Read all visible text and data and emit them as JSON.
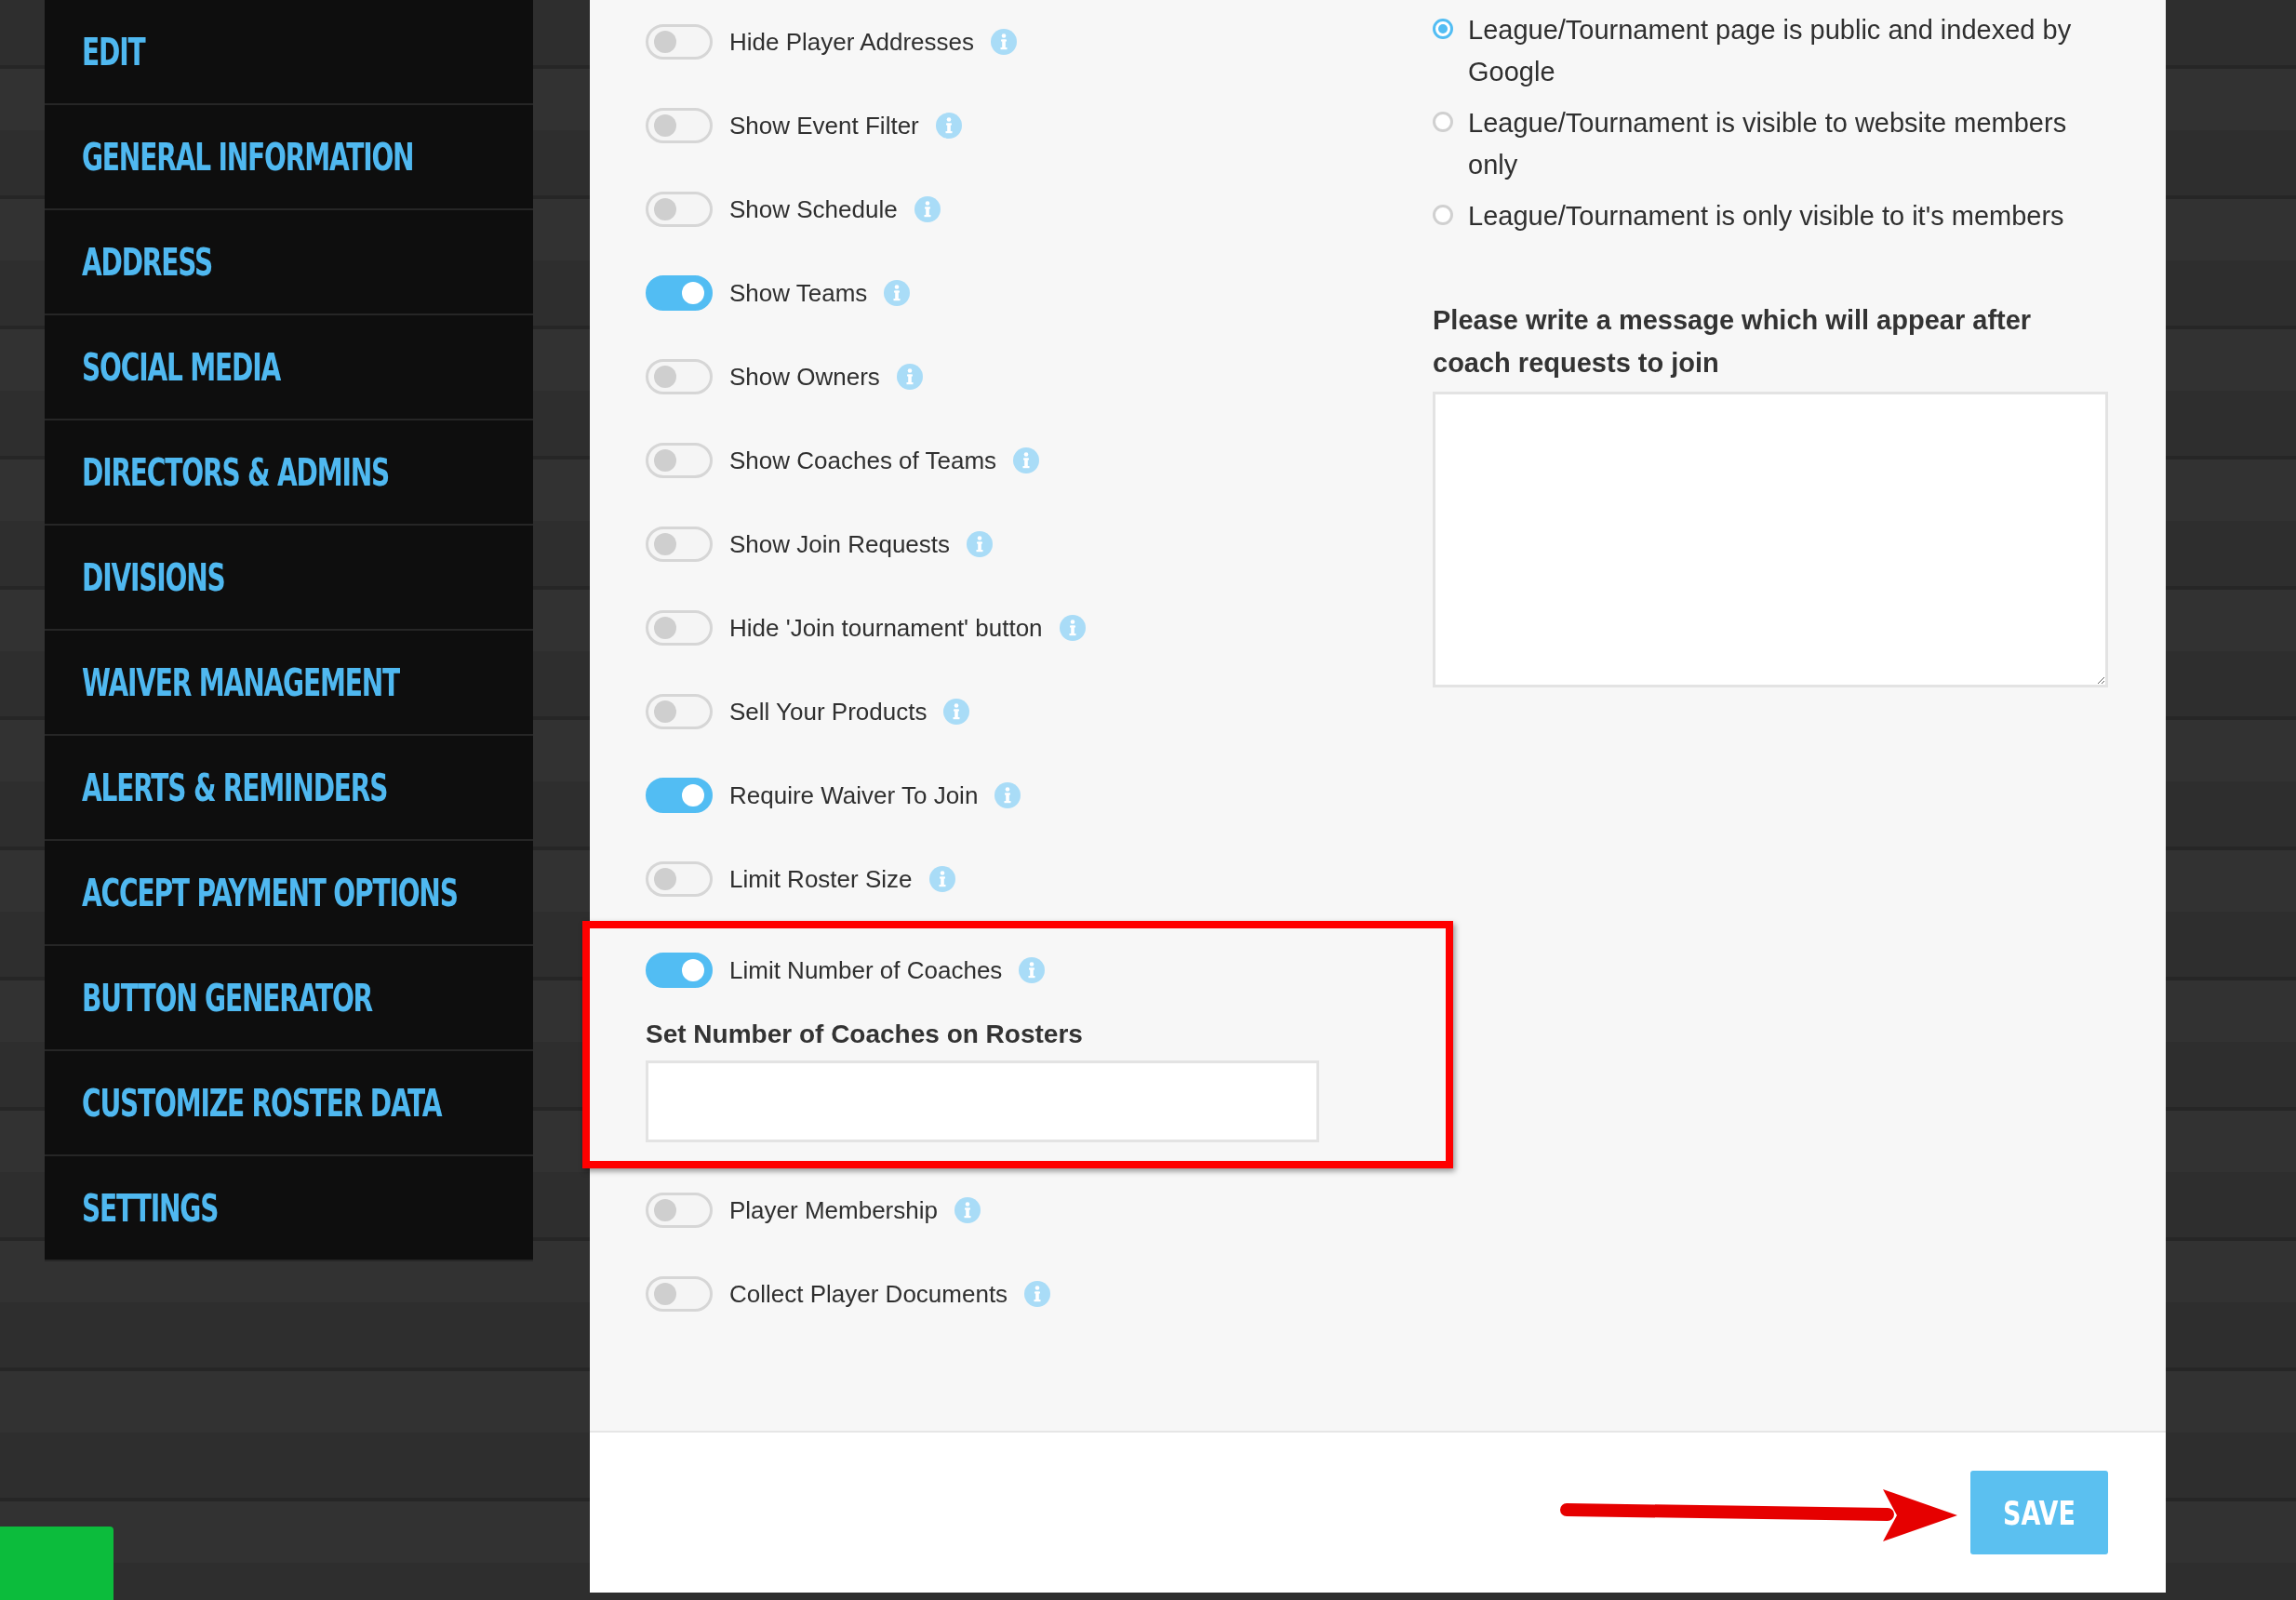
{
  "sidebar": {
    "items": [
      {
        "label": "EDIT"
      },
      {
        "label": "GENERAL INFORMATION"
      },
      {
        "label": "ADDRESS"
      },
      {
        "label": "SOCIAL MEDIA"
      },
      {
        "label": "DIRECTORS & ADMINS"
      },
      {
        "label": "DIVISIONS"
      },
      {
        "label": "WAIVER MANAGEMENT"
      },
      {
        "label": "ALERTS & REMINDERS"
      },
      {
        "label": "ACCEPT PAYMENT OPTIONS"
      },
      {
        "label": "BUTTON GENERATOR"
      },
      {
        "label": "CUSTOMIZE ROSTER DATA"
      },
      {
        "label": "SETTINGS"
      }
    ]
  },
  "toggles": [
    {
      "label": "Hide Player Addresses",
      "on": false
    },
    {
      "label": "Show Event Filter",
      "on": false
    },
    {
      "label": "Show Schedule",
      "on": false
    },
    {
      "label": "Show Teams",
      "on": true
    },
    {
      "label": "Show Owners",
      "on": false
    },
    {
      "label": "Show Coaches of Teams",
      "on": false
    },
    {
      "label": "Show Join Requests",
      "on": false
    },
    {
      "label": "Hide 'Join tournament' button",
      "on": false
    },
    {
      "label": "Sell Your Products",
      "on": false
    },
    {
      "label": "Require Waiver To Join",
      "on": true
    },
    {
      "label": "Limit Roster Size",
      "on": false
    },
    {
      "label": "Limit Number of Coaches",
      "on": true,
      "highlighted": true,
      "field": {
        "label": "Set Number of Coaches on Rosters"
      }
    },
    {
      "label": "Player Membership",
      "on": false
    },
    {
      "label": "Collect Player Documents",
      "on": false
    }
  ],
  "visibility": [
    {
      "label": "League/Tournament page is public and indexed by Google",
      "selected": true
    },
    {
      "label": "League/Tournament is visible to website members only",
      "selected": false
    },
    {
      "label": "League/Tournament is only visible to it's members",
      "selected": false
    }
  ],
  "message": {
    "label": "Please write a message which will appear after coach requests to join"
  },
  "save_button": {
    "label": "SAVE"
  }
}
